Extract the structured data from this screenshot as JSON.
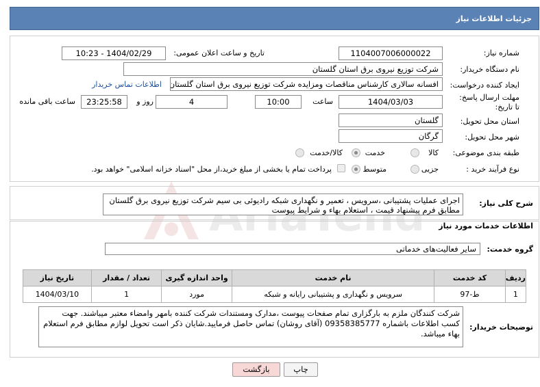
{
  "header": {
    "title": "جزئیات اطلاعات نیاز"
  },
  "form": {
    "need_number_label": "شماره نیاز:",
    "need_number": "1104007006000022",
    "announce_label": "تاریخ و ساعت اعلان عمومی:",
    "announce_value": "1404/02/29 - 10:23",
    "buyer_org_label": "نام دستگاه خریدار:",
    "buyer_org": "شرکت توزیع نیروی برق استان گلستان",
    "creator_label": "ایجاد کننده درخواست:",
    "creator": "افسانه سالاری کارشناس مناقصات ومزایده شرکت توزیع نیروی برق استان گلستان",
    "contact_link": "اطلاعات تماس خریدار",
    "deadline_label": "مهلت ارسال پاسخ: تا تاریخ:",
    "deadline_date": "1404/03/03",
    "time_label": "ساعت",
    "deadline_time": "10:00",
    "days_value": "4",
    "days_label": "روز و",
    "remaining_time": "23:25:58",
    "remaining_label": "ساعت باقی مانده",
    "province_label": "استان محل تحویل:",
    "province": "گلستان",
    "city_label": "شهر محل تحویل:",
    "city": "گرگان",
    "category_label": "طبقه بندی موضوعی:",
    "category_options": [
      "کالا",
      "خدمت",
      "کالا/خدمت"
    ],
    "category_selected": "خدمت",
    "process_label": "نوع فرآیند خرید :",
    "process_options": [
      "جزیی",
      "متوسط"
    ],
    "process_selected": "متوسط",
    "payment_note": "پرداخت تمام یا بخشی از مبلغ خرید،از محل \"اسناد خزانه اسلامی\" خواهد بود."
  },
  "description": {
    "label": "شرح کلی نیاز:",
    "text": "اجرای عملیات پشتیبانی ،سرویس ، تعمیر و نگهداری شبکه رادیوئی بی سیم شرکت توزیع نیروی برق گلستان مطابق فرم پیشنهاد قیمت ، استعلام بهاء و شرایط پیوست"
  },
  "services": {
    "section_title": "اطلاعات خدمات مورد نیاز",
    "group_label": "گروه خدمت:",
    "group_value": "سایر فعالیت‌های خدماتی",
    "columns": [
      "ردیف",
      "کد خدمت",
      "نام خدمت",
      "واحد اندازه گیری",
      "تعداد / مقدار",
      "تاریخ نیاز"
    ],
    "rows": [
      {
        "index": "1",
        "code": "ط-97",
        "name": "سرویس و نگهداری و پشتیبانی رایانه و شبکه",
        "unit": "مورد",
        "qty": "1",
        "date": "1404/03/10"
      }
    ]
  },
  "buyer_notes": {
    "label": "توضیحات خریدار:",
    "text": "شرکت کنندگان ملزم به بارگزاری تمام صفحات پیوست ،مدارک ومستندات شرکت کننده بامهر وامضاء معتبر میباشند. جهت کسب اطلاعات باشماره 09358385777 (آقای روشان) تماس حاصل فرمایید.شایان ذکر است تحویل لوازم مطابق فرم استعلام بهاء میباشد."
  },
  "buttons": {
    "print": "چاپ",
    "back": "بازگشت"
  },
  "colors": {
    "header_bg": "#5b82b5",
    "back_button_bg": "#f8d7d7",
    "link": "#1a4f9c"
  }
}
